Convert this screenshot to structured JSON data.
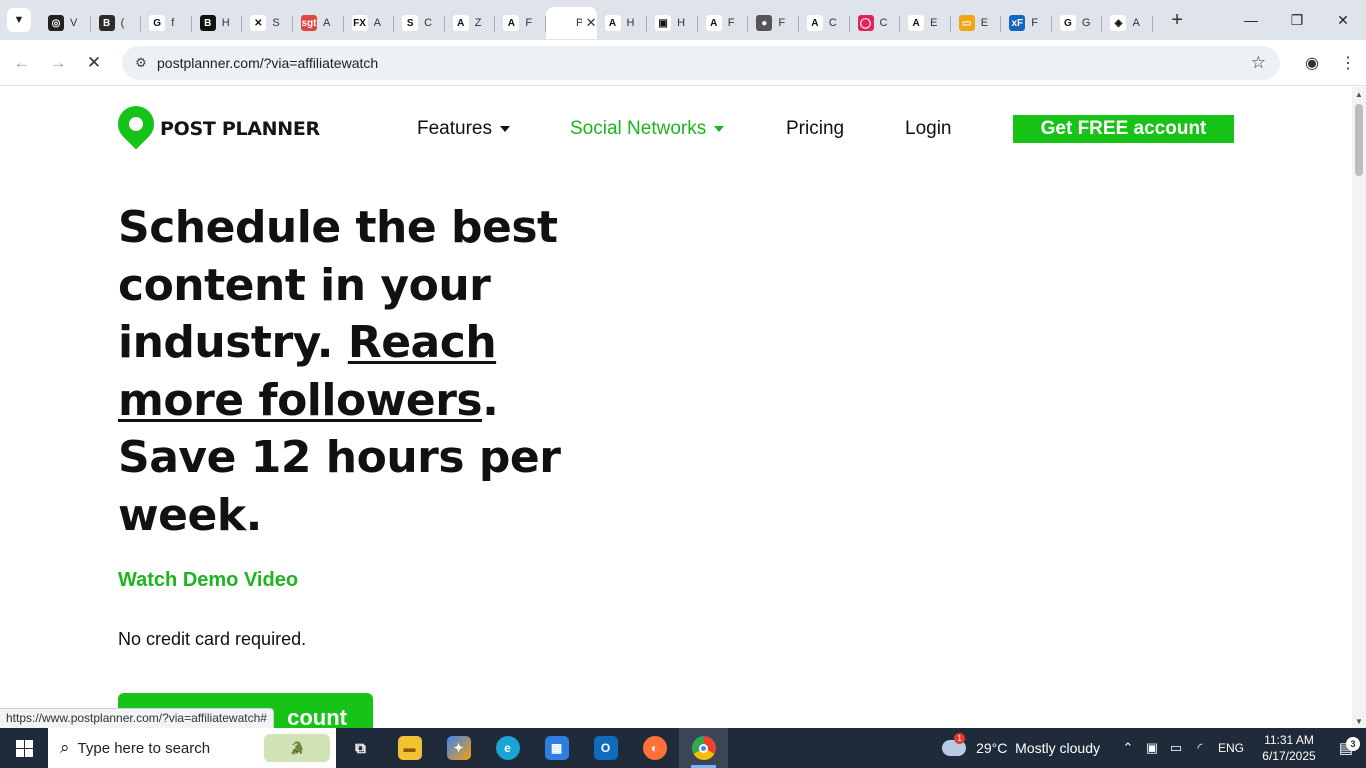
{
  "browser": {
    "tabs": [
      {
        "icon": "openai-icon",
        "fav_color": "#222222",
        "fav_text": "◎",
        "title": "V"
      },
      {
        "icon": "bing-b-icon",
        "fav_color": "#2b2b2b",
        "fav_text": "B",
        "title": "("
      },
      {
        "icon": "google-icon",
        "fav_color": "#ffffff",
        "fav_text": "G",
        "title": "f"
      },
      {
        "icon": "business-icon",
        "fav_color": "#111111",
        "fav_text": "B",
        "title": "H"
      },
      {
        "icon": "x-arrow-icon",
        "fav_color": "#ffffff",
        "fav_text": "✕",
        "title": "S"
      },
      {
        "icon": "sgt-icon",
        "fav_color": "#e0483e",
        "fav_text": "sgt",
        "title": "A"
      },
      {
        "icon": "simplefx-icon",
        "fav_color": "#ffffff",
        "fav_text": "FX",
        "title": "A"
      },
      {
        "icon": "s-leaf-icon",
        "fav_color": "#ffffff",
        "fav_text": "S",
        "title": "C"
      },
      {
        "icon": "a-icon",
        "fav_color": "#ffffff",
        "fav_text": "A",
        "title": "Z"
      },
      {
        "icon": "a-icon",
        "fav_color": "#ffffff",
        "fav_text": "A",
        "title": "F"
      },
      {
        "icon": "postplanner-icon",
        "fav_color": "#ffffff",
        "fav_text": "",
        "title": "P",
        "active": true
      },
      {
        "icon": "a-icon",
        "fav_color": "#ffffff",
        "fav_text": "A",
        "title": "H"
      },
      {
        "icon": "image-icon",
        "fav_color": "#ffffff",
        "fav_text": "▣",
        "title": "H"
      },
      {
        "icon": "a-icon",
        "fav_color": "#ffffff",
        "fav_text": "A",
        "title": "F"
      },
      {
        "icon": "profile-photo-icon",
        "fav_color": "#555555",
        "fav_text": "●",
        "title": "F"
      },
      {
        "icon": "a-icon",
        "fav_color": "#ffffff",
        "fav_text": "A",
        "title": "C"
      },
      {
        "icon": "record-icon",
        "fav_color": "#e0245e",
        "fav_text": "◯",
        "title": "C"
      },
      {
        "icon": "a-icon",
        "fav_color": "#ffffff",
        "fav_text": "A",
        "title": "E"
      },
      {
        "icon": "tv-icon",
        "fav_color": "#f2a516",
        "fav_text": "▭",
        "title": "E"
      },
      {
        "icon": "xf-icon",
        "fav_color": "#1565c0",
        "fav_text": "xF",
        "title": "F"
      },
      {
        "icon": "google-icon",
        "fav_color": "#ffffff",
        "fav_text": "G",
        "title": "G"
      },
      {
        "icon": "tool-icon",
        "fav_color": "#ffffff",
        "fav_text": "◈",
        "title": "A"
      }
    ],
    "url": "postplanner.com/?via=affiliatewatch",
    "status_url": "https://www.postplanner.com/?via=affiliatewatch#"
  },
  "page": {
    "logo_text": "POST PLANNER",
    "nav": {
      "features": "Features",
      "social_networks": "Social Networks",
      "pricing": "Pricing",
      "login": "Login"
    },
    "cta_top": "Get FREE account",
    "hero": {
      "line_a": "Schedule the best content in your industry. ",
      "link": "Reach more followers",
      "line_b": ". Save 12 hours per week."
    },
    "demo_link": "Watch Demo Video",
    "no_cc": "No credit card required.",
    "cta_bottom": "count"
  },
  "taskbar": {
    "search_placeholder": "Type here to search",
    "weather_temp": "29°C",
    "weather_text": "Mostly cloudy",
    "weather_badge": "1",
    "lang": "ENG",
    "time": "11:31 AM",
    "date": "6/17/2025",
    "notification_count": "3"
  },
  "colors": {
    "brand_green": "#17c317",
    "link_green": "#1db41d",
    "taskbar_bg": "#1f2b3a"
  }
}
